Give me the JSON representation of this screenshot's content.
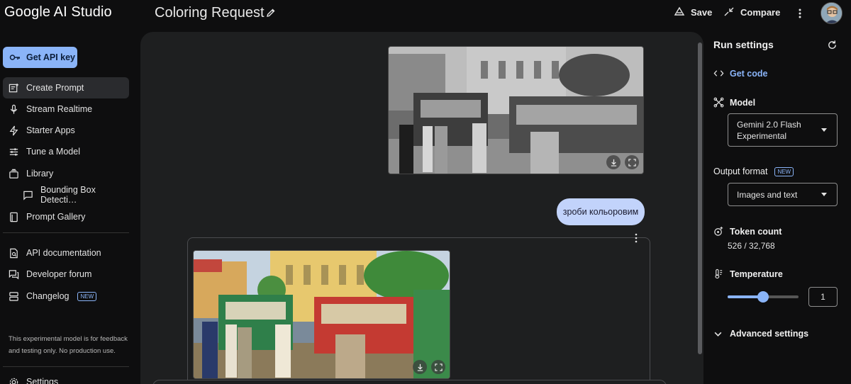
{
  "app": {
    "logo": "Google AI Studio",
    "prompt_title": "Coloring Request"
  },
  "header": {
    "save_label": "Save",
    "compare_label": "Compare"
  },
  "sidebar": {
    "api_key_label": "Get API key",
    "items": [
      {
        "label": "Create Prompt",
        "icon": "create-prompt-icon"
      },
      {
        "label": "Stream Realtime",
        "icon": "mic-icon"
      },
      {
        "label": "Starter Apps",
        "icon": "bolt-icon"
      },
      {
        "label": "Tune a Model",
        "icon": "tune-icon"
      },
      {
        "label": "Library",
        "icon": "library-icon"
      },
      {
        "label": "Bounding Box Detecti…",
        "icon": "chat-icon"
      },
      {
        "label": "Prompt Gallery",
        "icon": "gallery-icon"
      },
      {
        "label": "API documentation",
        "icon": "docs-icon"
      },
      {
        "label": "Developer forum",
        "icon": "forum-icon"
      },
      {
        "label": "Changelog",
        "icon": "changelog-icon",
        "badge": "NEW"
      },
      {
        "label": "Settings",
        "icon": "gear-icon"
      }
    ],
    "disclaimer": "This experimental model is for feedback and testing only. No production use."
  },
  "chat": {
    "user_message": "зроби кольоровим"
  },
  "run_settings": {
    "title": "Run settings",
    "get_code": "Get code",
    "model_label": "Model",
    "model_value": "Gemini 2.0 Flash Experimental",
    "output_format_label": "Output format",
    "output_format_badge": "NEW",
    "output_format_value": "Images and text",
    "token_label": "Token count",
    "token_value": "526 / 32,768",
    "temperature_label": "Temperature",
    "temperature_value": "1",
    "temperature_fraction": 0.5,
    "advanced_label": "Advanced settings"
  },
  "colors": {
    "accent": "#8ab4f8",
    "bubble": "#c2d3fb",
    "panel": "#1e1f20"
  }
}
